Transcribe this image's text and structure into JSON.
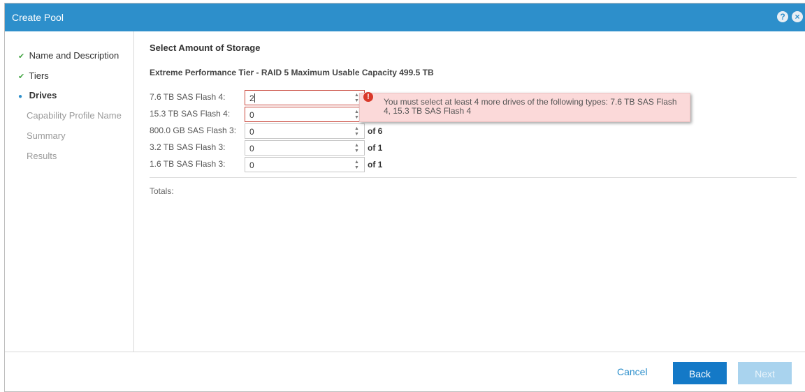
{
  "window": {
    "title": "Create Pool",
    "help_icon": "?",
    "close_icon": "×"
  },
  "sidebar": {
    "steps": [
      {
        "label": "Name and Description",
        "state": "done",
        "mark": "✔"
      },
      {
        "label": "Tiers",
        "state": "done",
        "mark": "✔"
      },
      {
        "label": "Drives",
        "state": "current",
        "mark": "●"
      },
      {
        "label": "Capability Profile Name",
        "state": "pending"
      },
      {
        "label": "Summary",
        "state": "pending"
      },
      {
        "label": "Results",
        "state": "pending"
      }
    ]
  },
  "main": {
    "section_title": "Select Amount of Storage",
    "tier_title": "Extreme Performance Tier - RAID 5 Maximum Usable Capacity 499.5 TB",
    "drives": [
      {
        "label": "7.6 TB SAS Flash 4:",
        "value": "2",
        "of": "",
        "error": true
      },
      {
        "label": "15.3 TB SAS Flash 4:",
        "value": "0",
        "of": "",
        "error": true
      },
      {
        "label": "800.0 GB SAS Flash 3:",
        "value": "0",
        "of": "of 6",
        "error": false
      },
      {
        "label": "3.2 TB SAS Flash 3:",
        "value": "0",
        "of": "of 1",
        "error": false
      },
      {
        "label": "1.6 TB SAS Flash 3:",
        "value": "0",
        "of": "of 1",
        "error": false
      }
    ],
    "error_message": "You must select at least 4 more drives of the following types: 7.6 TB SAS Flash 4, 15.3 TB SAS Flash 4",
    "error_icon": "!",
    "totals_label": "Totals:"
  },
  "footer": {
    "cancel_label": "Cancel",
    "back_label": "Back",
    "next_label": "Next"
  },
  "colors": {
    "title_bar": "#2d8fcb",
    "primary_button": "#1479c7",
    "disabled_button": "#a9d3ee",
    "error_border": "#c9473c",
    "error_bg": "#fbd9d9",
    "check_green": "#46a546"
  }
}
